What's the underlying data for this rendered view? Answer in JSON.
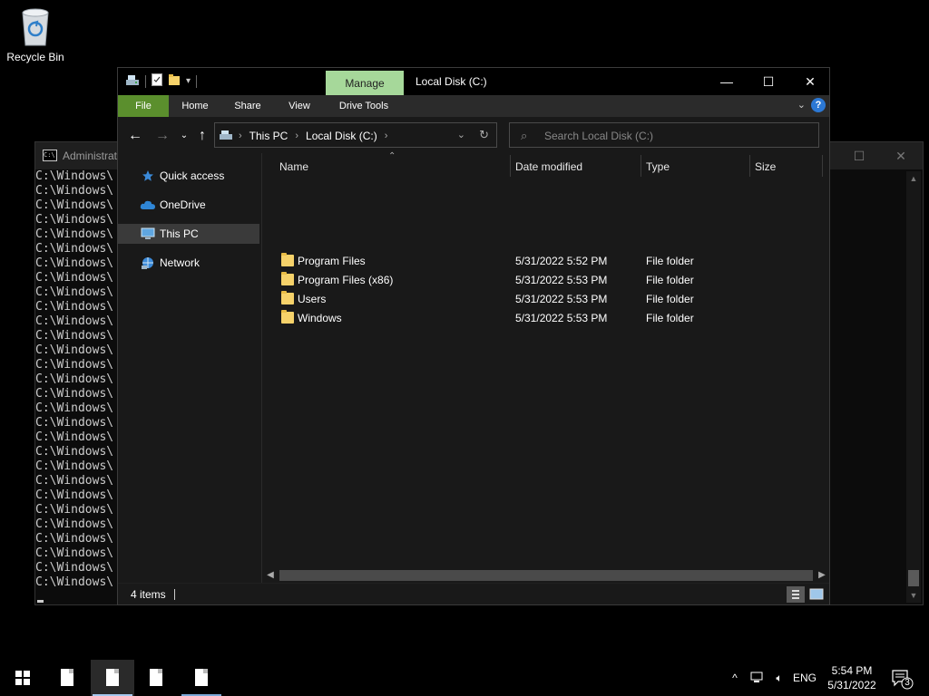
{
  "desktop": {
    "recycle_bin_label": "Recycle Bin"
  },
  "console": {
    "title": "Administrat",
    "line_text": "C:\\Windows\\",
    "line_count": 29
  },
  "explorer": {
    "title": "Local Disk (C:)",
    "manage_tab": "Manage",
    "ribbon_tabs": {
      "file": "File",
      "home": "Home",
      "share": "Share",
      "view": "View",
      "drive_tools": "Drive Tools"
    },
    "breadcrumb": [
      "This PC",
      "Local Disk (C:)"
    ],
    "search_placeholder": "Search Local Disk (C:)",
    "sidebar": [
      {
        "label": "Quick access",
        "icon": "star-icon"
      },
      {
        "label": "OneDrive",
        "icon": "cloud-icon"
      },
      {
        "label": "This PC",
        "icon": "pc-icon",
        "selected": true
      },
      {
        "label": "Network",
        "icon": "network-icon"
      }
    ],
    "columns": {
      "name": "Name",
      "date": "Date modified",
      "type": "Type",
      "size": "Size"
    },
    "rows": [
      {
        "name": "Program Files",
        "date": "5/31/2022 5:52 PM",
        "type": "File folder"
      },
      {
        "name": "Program Files (x86)",
        "date": "5/31/2022 5:53 PM",
        "type": "File folder"
      },
      {
        "name": "Users",
        "date": "5/31/2022 5:53 PM",
        "type": "File folder"
      },
      {
        "name": "Windows",
        "date": "5/31/2022 5:53 PM",
        "type": "File folder"
      }
    ],
    "status": "4 items"
  },
  "taskbar": {
    "language": "ENG",
    "time": "5:54 PM",
    "date": "5/31/2022",
    "notification_count": "3"
  },
  "colors": {
    "manage_tab": "#a6d89a",
    "file_tab": "#5b8f2d",
    "folder": "#f6d26a"
  }
}
